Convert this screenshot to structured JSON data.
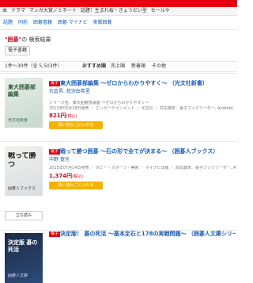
{
  "nav": {
    "menu_items": [
      "本",
      "ドラマ",
      "マンガ大賞ノミネート",
      "話題！生まれ桜・きょうだい型",
      "セールや"
    ]
  },
  "filters": {
    "items": [
      "話題",
      "同前",
      "囲碁書籍",
      "囲碁 マイナビ",
      "実戦囲碁"
    ]
  },
  "search": {
    "keyword": "\"囲碁\"",
    "heading_suffix": "の 検索結果",
    "chip": "電子書籍",
    "result_count": "1件〜30件（全 5,503件）",
    "sort_label": "おすすめ順",
    "sort_options": [
      "売上順",
      "新着順",
      "その他"
    ]
  },
  "results": [
    {
      "badge": "電子",
      "title": "東大囲碁部編集 〜ゼロからわかりやすく〜 （光文社新書）",
      "author": "石倉昇, 蛙沢由希里",
      "series": "シリーズ名：東大囲碁部講座 〜ゼロからわかりやすく〜",
      "meta": "2013年03月18日発売 ／ エンターテインメント ／ 光文社 ／ 対応端末：電子ブックリーダー, Android, iPhone, iPad",
      "price": "821円",
      "price_tax": "(税込)",
      "cart_label": "買い物かごに入れる",
      "cover_title": "東大囲碁部編集",
      "cover_sub": "光文社新書"
    },
    {
      "badge": "電子",
      "title": "戦って勝つ囲碁 〜石の形で全てが決まる〜 （囲碁人ブックス）",
      "author": "中野 寛也",
      "meta": "2015年07月14日発売 ／ ホビー・スポーツ・美術 ／ マイナビ出版 ／ 対応端末：電子ブックリーダー, Android, iPhone, iPad",
      "price": "1,374円",
      "price_tax": "(税込)",
      "cart_label": "買い物かごに入れる",
      "standing_label": "立ち読み",
      "cover_title": "戦って勝つ",
      "cover_sub": "囲碁人ブックス"
    },
    {
      "badge": "電子",
      "title": "決定版！ 碁の死活 〜基本定石と178の実戦問題〜 （囲碁人文庫シリーズ）",
      "cover_title": "決定版 碁の死活",
      "cover_sub": "囲碁人文庫"
    }
  ]
}
